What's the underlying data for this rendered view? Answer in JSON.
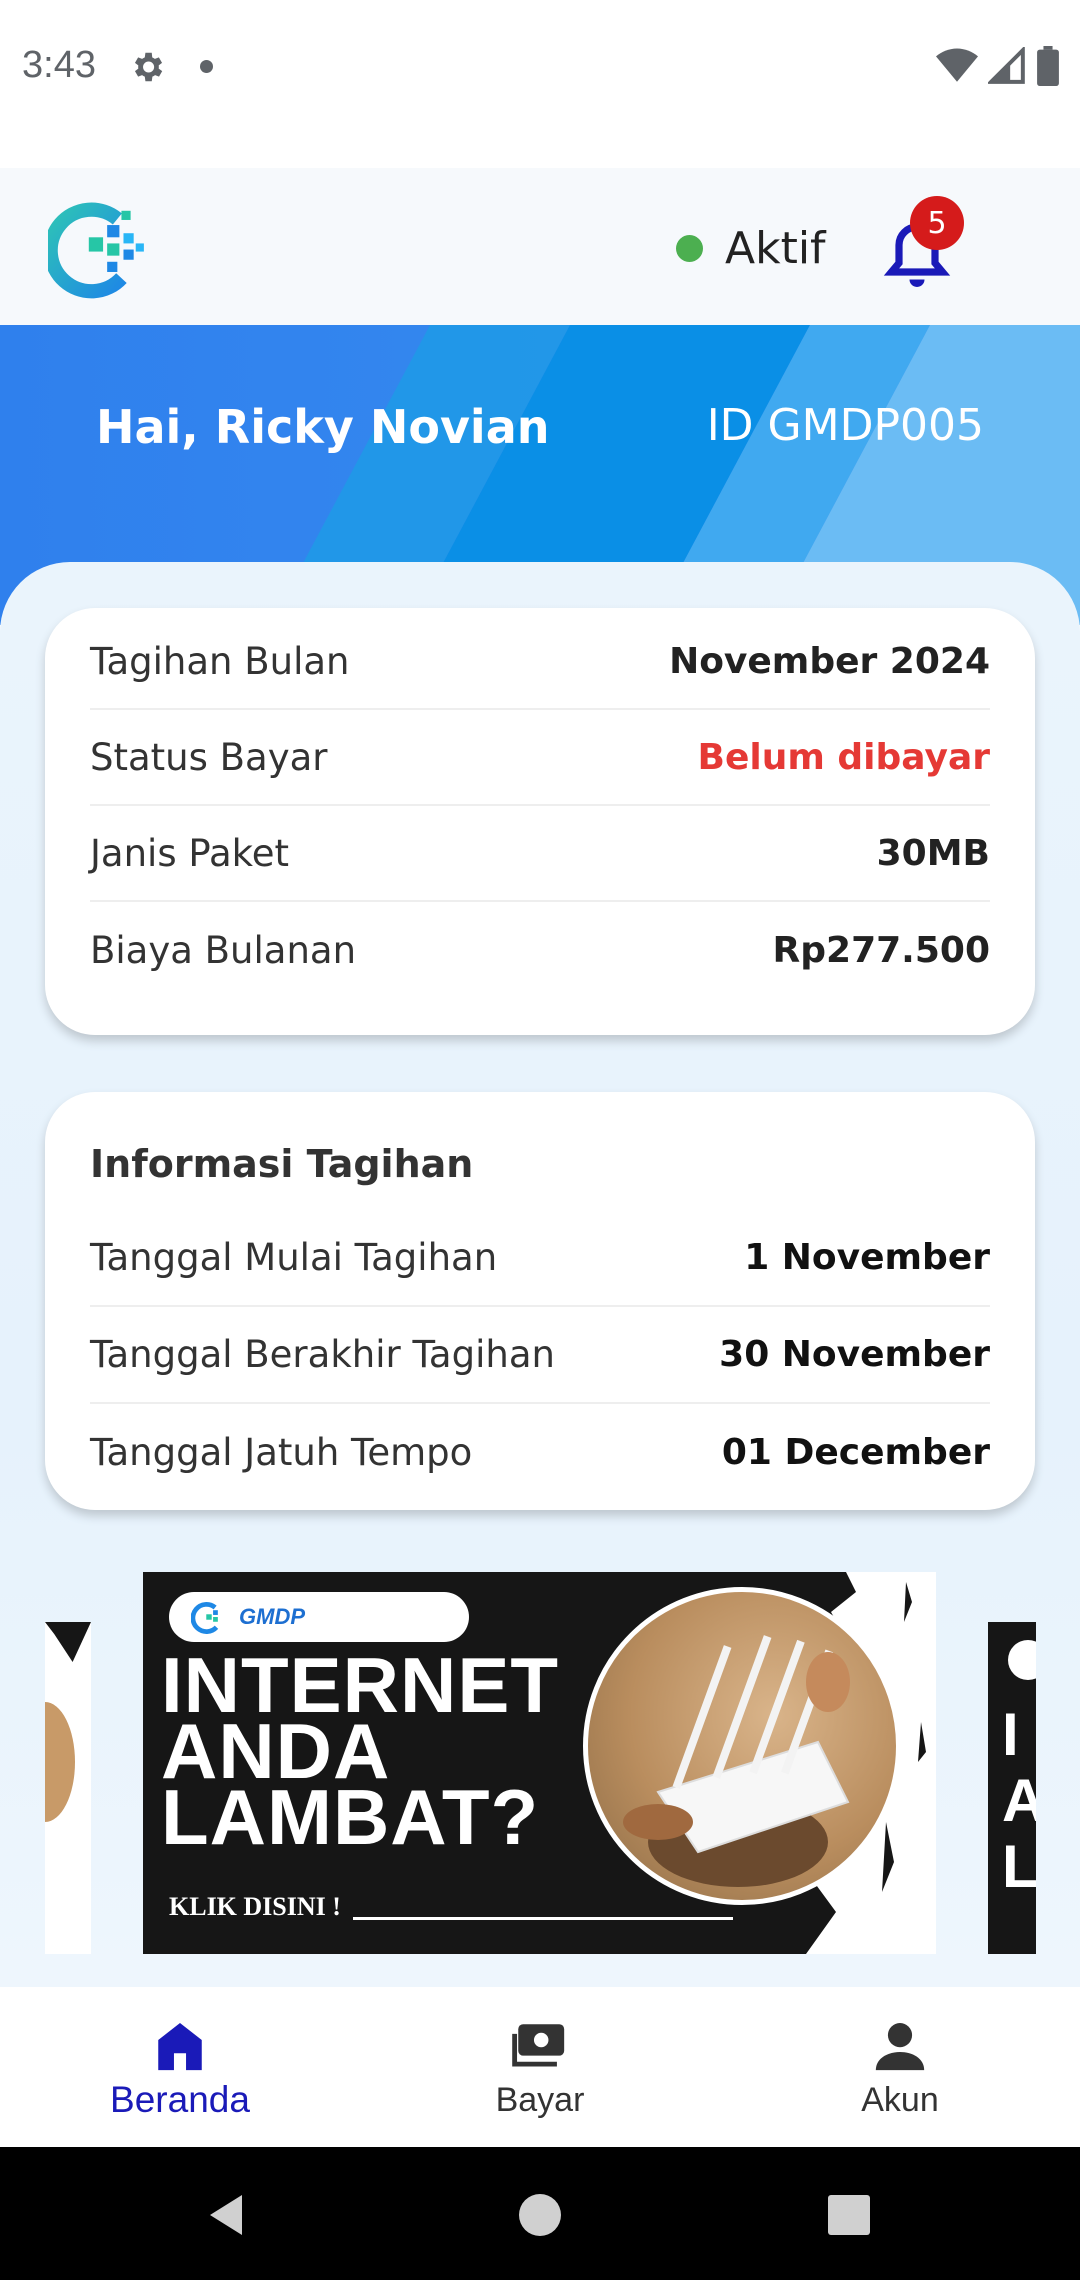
{
  "status_bar": {
    "time": "3:43",
    "icons": [
      "settings-icon",
      "notification-dot-icon",
      "wifi-icon",
      "signal-icon",
      "battery-icon"
    ]
  },
  "header": {
    "logo": "gmdp-logo",
    "status_label": "Aktif",
    "status_color": "#4caf50",
    "notification_count": "5"
  },
  "hero": {
    "greeting": "Hai, Ricky Novian",
    "customer_id": "ID GMDP005"
  },
  "billing_card": {
    "rows": [
      {
        "label": "Tagihan Bulan",
        "value": "November 2024"
      },
      {
        "label": "Status Bayar",
        "value": "Belum dibayar",
        "color": "#e53935"
      },
      {
        "label": "Janis Paket",
        "value": "30MB"
      },
      {
        "label": "Biaya Bulanan",
        "value": "Rp277.500"
      }
    ]
  },
  "info_card": {
    "title": "Informasi Tagihan",
    "rows": [
      {
        "label": "Tanggal Mulai Tagihan",
        "value": "1 November"
      },
      {
        "label": "Tanggal Berakhir Tagihan",
        "value": "30 November"
      },
      {
        "label": "Tanggal Jatuh Tempo",
        "value": "01 December"
      }
    ]
  },
  "promo": {
    "brand": "GMDP",
    "headline": "INTERNET ANDA LAMBAT?",
    "cta": "KLIK DISINI !"
  },
  "bottom_nav": {
    "items": [
      {
        "label": "Beranda",
        "icon": "home-icon",
        "active": true
      },
      {
        "label": "Bayar",
        "icon": "payment-icon",
        "active": false
      },
      {
        "label": "Akun",
        "icon": "person-icon",
        "active": false
      }
    ]
  },
  "colors": {
    "accent": "#1a1ab8",
    "hero_blue": "#2f8ae8",
    "alert_red": "#e53935"
  }
}
